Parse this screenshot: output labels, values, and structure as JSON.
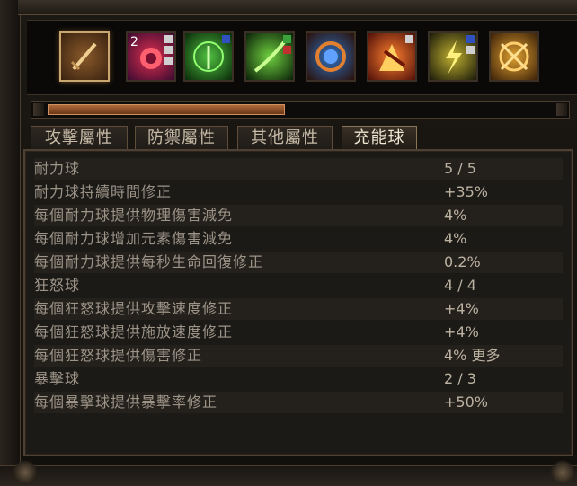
{
  "skills": [
    {
      "name": "sword-skill-icon",
      "active": true
    },
    {
      "name": "heart-burst-skill-icon",
      "count": "2",
      "gems": [
        "w",
        "w",
        "w"
      ]
    },
    {
      "name": "nature-figure-skill-icon",
      "gems": [
        "b"
      ]
    },
    {
      "name": "green-blade-skill-icon",
      "gems": [
        "g",
        "r"
      ]
    },
    {
      "name": "blue-swirl-skill-icon"
    },
    {
      "name": "fire-strike-skill-icon",
      "gems": [
        "w"
      ]
    },
    {
      "name": "lightning-figure-skill-icon",
      "gems": [
        "b",
        "w"
      ]
    },
    {
      "name": "golden-crosshair-skill-icon"
    }
  ],
  "progress": {
    "fraction": 0.47
  },
  "tabs": [
    {
      "label": "攻擊屬性",
      "active": false
    },
    {
      "label": "防禦屬性",
      "active": false
    },
    {
      "label": "其他屬性",
      "active": false
    },
    {
      "label": "充能球",
      "active": true
    }
  ],
  "stats": [
    {
      "label": "耐力球",
      "value": "5 / 5"
    },
    {
      "label": "耐力球持續時間修正",
      "value": "+35%"
    },
    {
      "label": "每個耐力球提供物理傷害減免",
      "value": "4%"
    },
    {
      "label": "每個耐力球增加元素傷害減免",
      "value": "4%"
    },
    {
      "label": "每個耐力球提供每秒生命回復修正",
      "value": "0.2%"
    },
    {
      "label": "狂怒球",
      "value": "4 / 4"
    },
    {
      "label": "每個狂怒球提供攻擊速度修正",
      "value": "+4%"
    },
    {
      "label": "每個狂怒球提供施放速度修正",
      "value": "+4%"
    },
    {
      "label": "每個狂怒球提供傷害修正",
      "value": "4% 更多"
    },
    {
      "label": "暴擊球",
      "value": "2 / 3"
    },
    {
      "label": "每個暴擊球提供暴擊率修正",
      "value": "+50%"
    }
  ],
  "colors": {
    "accent": "#c8a870",
    "label": "#9d9488",
    "value": "#bcb2a2",
    "progress": "#b06a3a"
  }
}
